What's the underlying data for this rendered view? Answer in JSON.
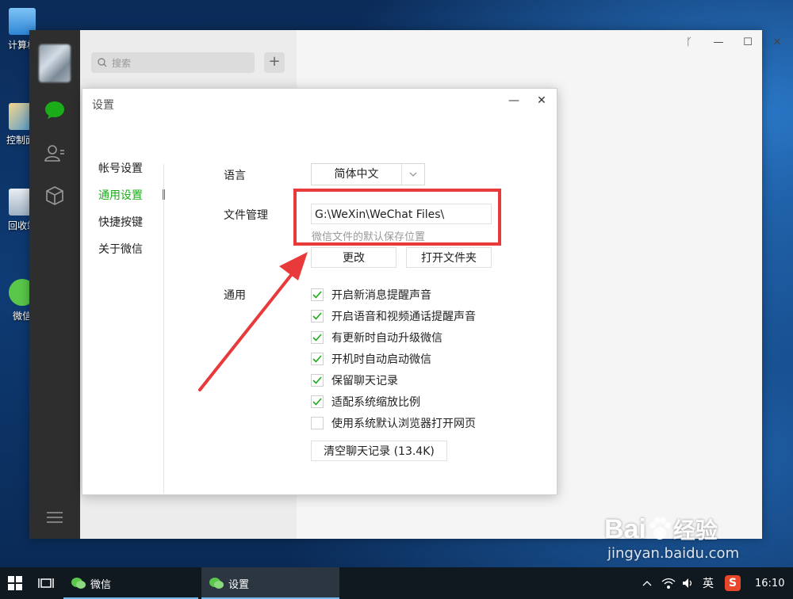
{
  "desktop": {
    "icons": [
      {
        "label": "计算机"
      },
      {
        "label": "控制面板"
      },
      {
        "label": "回收站"
      },
      {
        "label": "微信"
      }
    ]
  },
  "wechat": {
    "search_placeholder": "搜索",
    "plus_label": "+",
    "window_controls": {
      "pin": "ᚴ",
      "minimize": "—",
      "maximize": "☐",
      "close": "✕"
    }
  },
  "settings": {
    "title": "设置",
    "controls": {
      "minimize": "—",
      "close": "✕"
    },
    "menu": [
      {
        "label": "帐号设置"
      },
      {
        "label": "通用设置"
      },
      {
        "label": "快捷按键"
      },
      {
        "label": "关于微信"
      }
    ],
    "language": {
      "label": "语言",
      "value": "简体中文"
    },
    "file_management": {
      "label": "文件管理",
      "path": "G:\\WeXin\\WeChat Files\\",
      "hint": "微信文件的默认保存位置",
      "change_button": "更改",
      "open_folder_button": "打开文件夹"
    },
    "general": {
      "label": "通用",
      "options": [
        {
          "label": "开启新消息提醒声音",
          "checked": true
        },
        {
          "label": "开启语音和视频通话提醒声音",
          "checked": true
        },
        {
          "label": "有更新时自动升级微信",
          "checked": true
        },
        {
          "label": "开机时自动启动微信",
          "checked": true
        },
        {
          "label": "保留聊天记录",
          "checked": true
        },
        {
          "label": "适配系统缩放比例",
          "checked": true
        },
        {
          "label": "使用系统默认浏览器打开网页",
          "checked": false
        }
      ],
      "clear_button": "清空聊天记录 (13.4K)"
    },
    "accent_color": "#1aad19",
    "highlight_color": "#e83a3a"
  },
  "taskbar": {
    "apps": [
      {
        "label": "微信"
      },
      {
        "label": "设置"
      }
    ],
    "ime": "英",
    "time": "16:10"
  },
  "watermark": {
    "brand": "Bai",
    "brand2": "经验",
    "url": "jingyan.baidu.com"
  }
}
